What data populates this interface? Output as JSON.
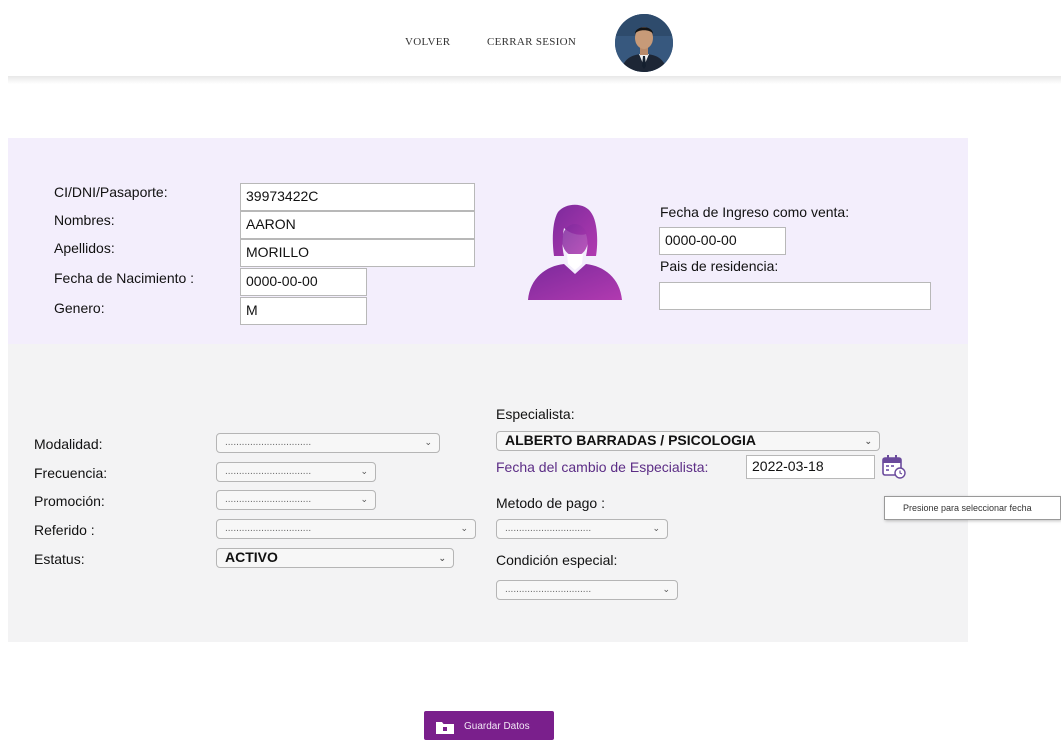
{
  "header": {
    "back_label": "VOLVER",
    "logout_label": "CERRAR SESION"
  },
  "personal": {
    "id_label": "CI/DNI/Pasaporte:",
    "id_value": "39973422C",
    "names_label": "Nombres:",
    "names_value": "AARON",
    "surnames_label": "Apellidos:",
    "surnames_value": "MORILLO",
    "birthdate_label": "Fecha de Nacimiento :",
    "birthdate_value": "0000-00-00",
    "gender_label": "Genero:",
    "gender_value": "M",
    "entry_date_label": "Fecha de Ingreso como venta:",
    "entry_date_value": "0000-00-00",
    "country_label": "Pais de residencia:",
    "country_value": ""
  },
  "service": {
    "modality_label": "Modalidad:",
    "modality_value": "...............................",
    "frequency_label": "Frecuencia:",
    "frequency_value": "...............................",
    "promotion_label": "Promoción:",
    "promotion_value": "...............................",
    "referred_label": "Referido :",
    "referred_value": "...............................",
    "status_label": "Estatus:",
    "status_value": "ACTIVO",
    "specialist_label": "Especialista:",
    "specialist_value": "ALBERTO BARRADAS / PSICOLOGIA",
    "specialist_change_label": "Fecha del cambio de Especialista:",
    "specialist_change_value": "2022-03-18",
    "payment_label": "Metodo de pago :",
    "payment_value": "...............................",
    "special_condition_label": "Condición especial:",
    "special_condition_value": "..............................."
  },
  "tooltip": "Presione para seleccionar fecha",
  "save_label": "Guardar Datos",
  "colors": {
    "accent": "#7a1f8c",
    "panel_top": "#f3eefc",
    "panel_bottom": "#f3f3f4",
    "label_purple": "#5c2d86"
  },
  "icons": {
    "user_silhouette": "female-user-icon",
    "calendar": "calendar-icon",
    "save": "folder-icon"
  }
}
